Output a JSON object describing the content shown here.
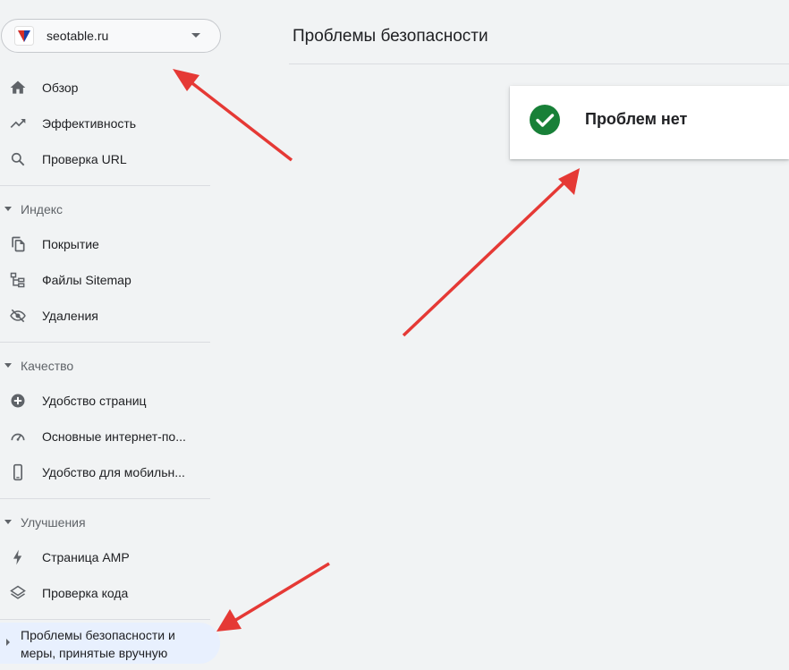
{
  "property": {
    "name": "seotable.ru",
    "logo_icon": "triangle-logo-icon"
  },
  "nav": {
    "top": [
      {
        "label": "Обзор",
        "icon": "home-icon"
      },
      {
        "label": "Эффективность",
        "icon": "trending-up-icon"
      },
      {
        "label": "Проверка URL",
        "icon": "search-icon"
      }
    ],
    "sections": [
      {
        "title": "Индекс",
        "items": [
          {
            "label": "Покрытие",
            "icon": "file-copy-icon"
          },
          {
            "label": "Файлы Sitemap",
            "icon": "sitemap-icon"
          },
          {
            "label": "Удаления",
            "icon": "eye-off-icon"
          }
        ]
      },
      {
        "title": "Качество",
        "items": [
          {
            "label": "Удобство страниц",
            "icon": "add-circle-icon"
          },
          {
            "label": "Основные интернет-по...",
            "icon": "speedometer-icon"
          },
          {
            "label": "Удобство для мобильн...",
            "icon": "smartphone-icon"
          }
        ]
      },
      {
        "title": "Улучшения",
        "items": [
          {
            "label": "Страница AMP",
            "icon": "bolt-icon"
          },
          {
            "label": "Проверка кода",
            "icon": "layers-icon"
          }
        ]
      }
    ],
    "active": {
      "label": "Проблемы безопасности и меры, принятые вручную"
    }
  },
  "main": {
    "title": "Проблемы безопасности",
    "status": {
      "text": "Проблем нет",
      "icon": "check-circle-icon",
      "color": "#188038"
    }
  },
  "colors": {
    "accent_bg": "#e8f0fe",
    "annotation_arrow": "#e53935"
  }
}
